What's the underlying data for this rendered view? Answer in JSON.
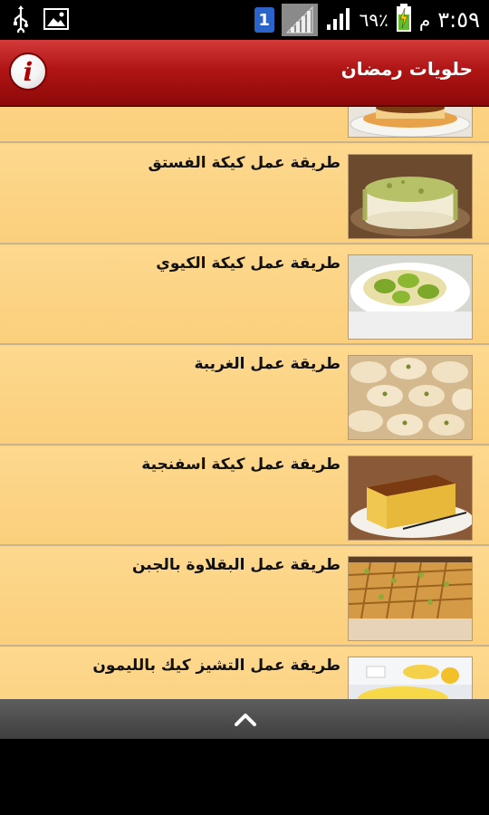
{
  "status_bar": {
    "battery_percent": "٦٩٪",
    "time": "٣:٥٩",
    "ampm": "م",
    "notification_count": "1",
    "icons": [
      "usb-icon",
      "image-icon",
      "notification-icon",
      "signal-icon",
      "wifi-signal-icon",
      "battery-charging-icon"
    ]
  },
  "app_bar": {
    "title": "حلويات رمضان",
    "info_glyph": "i"
  },
  "list": {
    "items": [
      {
        "title": "",
        "thumb": "flan"
      },
      {
        "title": "طريقة عمل كيكة الفستق",
        "thumb": "pistachio-cake"
      },
      {
        "title": "طريقة عمل كيكة الكيوي",
        "thumb": "kiwi-cake"
      },
      {
        "title": "طريقة عمل الغريبة",
        "thumb": "ghoraiba-cookies"
      },
      {
        "title": "طريقة عمل كيكة اسفنجية",
        "thumb": "sponge-cake"
      },
      {
        "title": "طريقة عمل البقلاوة بالجبن",
        "thumb": "baklava"
      },
      {
        "title": "طريقة عمل التشيز كيك بالليمون",
        "thumb": "lemon-cheesecake"
      }
    ]
  },
  "bottom_bar": {
    "icon": "chevron-up-icon"
  }
}
